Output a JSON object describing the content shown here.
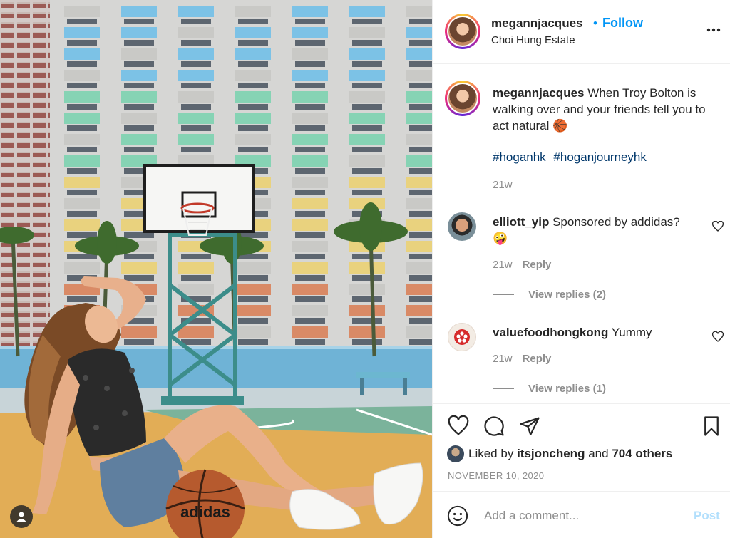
{
  "post": {
    "username": "megannjacques",
    "follow_dot": "•",
    "follow_label": "Follow",
    "location": "Choi Hung Estate",
    "more_icon": "more-horizontal-icon"
  },
  "caption": {
    "username": "megannjacques",
    "text": "When Troy Bolton is walking over and your friends tell you to act natural",
    "emoji": "🏀",
    "hashtags": [
      "#hoganhk",
      "#hoganjourneyhk"
    ],
    "age": "21w"
  },
  "comments": [
    {
      "username": "elliott_yip",
      "text": "Sponsored by addidas?",
      "emoji": "🤪",
      "age": "21w",
      "reply_label": "Reply",
      "view_replies": "View replies (2)"
    },
    {
      "username": "valuefoodhongkong",
      "text": "Yummy",
      "emoji": "",
      "age": "21w",
      "reply_label": "Reply",
      "view_replies": "View replies (1)"
    }
  ],
  "actions": {
    "liked_prefix": "Liked by",
    "liked_user": "itsjoncheng",
    "liked_and": "and",
    "liked_others": "704 others",
    "date": "NOVEMBER 10, 2020"
  },
  "add_comment": {
    "placeholder": "Add a comment...",
    "post_label": "Post"
  },
  "ball_brand": "adidas",
  "colors": {
    "accent": "#0095f6",
    "post_disabled": "#b2dffc",
    "hashtag": "#00376b",
    "muted": "#8e8e8e",
    "border": "#efefef"
  }
}
